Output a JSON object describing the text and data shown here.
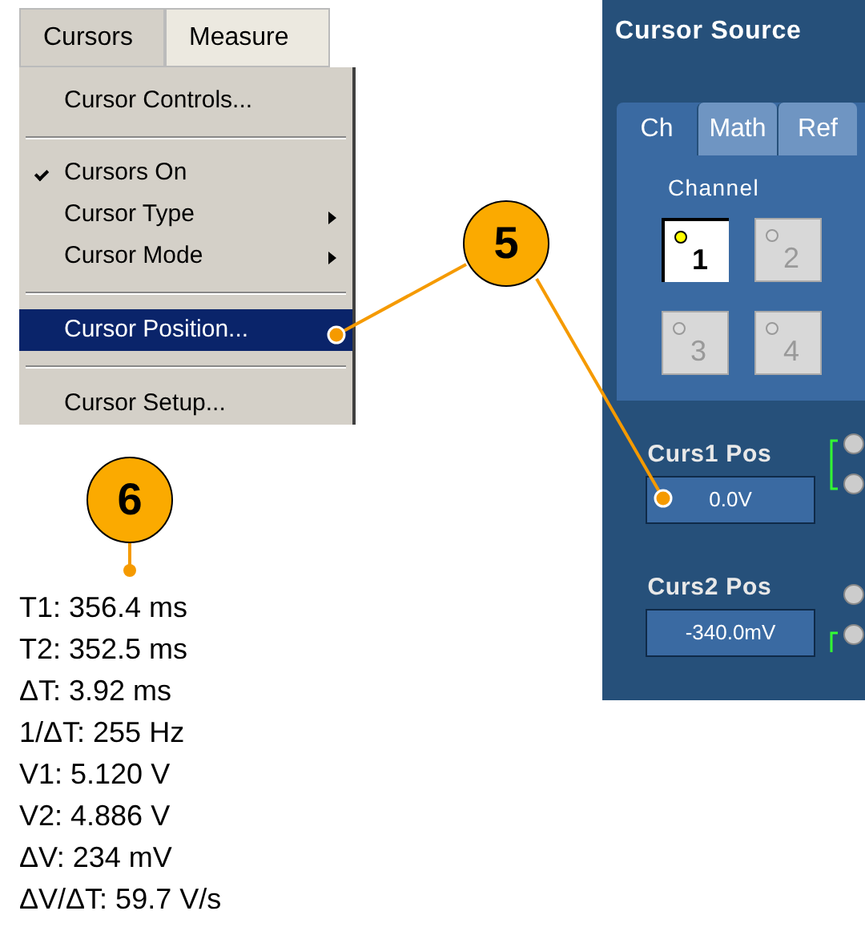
{
  "menu": {
    "tabs": [
      {
        "label": "Cursors",
        "selected": true
      },
      {
        "label": "Measure",
        "selected": false
      }
    ],
    "items": [
      {
        "kind": "item",
        "label": "Cursor Controls...",
        "checked": false,
        "submenu": false,
        "selected": false
      },
      {
        "kind": "separator"
      },
      {
        "kind": "item",
        "label": "Cursors On",
        "checked": true,
        "submenu": false,
        "selected": false
      },
      {
        "kind": "item",
        "label": "Cursor Type",
        "checked": false,
        "submenu": true,
        "selected": false
      },
      {
        "kind": "item",
        "label": "Cursor Mode",
        "checked": false,
        "submenu": true,
        "selected": false
      },
      {
        "kind": "separator"
      },
      {
        "kind": "item",
        "label": "Cursor Position...",
        "checked": false,
        "submenu": false,
        "selected": true
      },
      {
        "kind": "separator"
      },
      {
        "kind": "item",
        "label": "Cursor Setup...",
        "checked": false,
        "submenu": false,
        "selected": false
      }
    ]
  },
  "cursor_panel": {
    "title": "Cursor Source",
    "tabs": [
      {
        "label": "Ch",
        "selected": true
      },
      {
        "label": "Math",
        "selected": false
      },
      {
        "label": "Ref",
        "selected": false
      }
    ],
    "group_label": "Channel",
    "channels": [
      {
        "label": "1",
        "selected": true
      },
      {
        "label": "2",
        "selected": false
      },
      {
        "label": "3",
        "selected": false
      },
      {
        "label": "4",
        "selected": false
      }
    ],
    "positions": [
      {
        "label": "Curs1 Pos",
        "value": "0.0V"
      },
      {
        "label": "Curs2 Pos",
        "value": "-340.0mV"
      }
    ]
  },
  "callouts": [
    {
      "label": "5"
    },
    {
      "label": "6"
    }
  ],
  "readouts": [
    "T1: 356.4 ms",
    "T2: 352.5 ms",
    "ΔT: 3.92 ms",
    "1/ΔT: 255 Hz",
    "V1: 5.120 V",
    "V2: 4.886 V",
    "ΔV: 234 mV",
    "ΔV/ΔT: 59.7 V/s"
  ]
}
